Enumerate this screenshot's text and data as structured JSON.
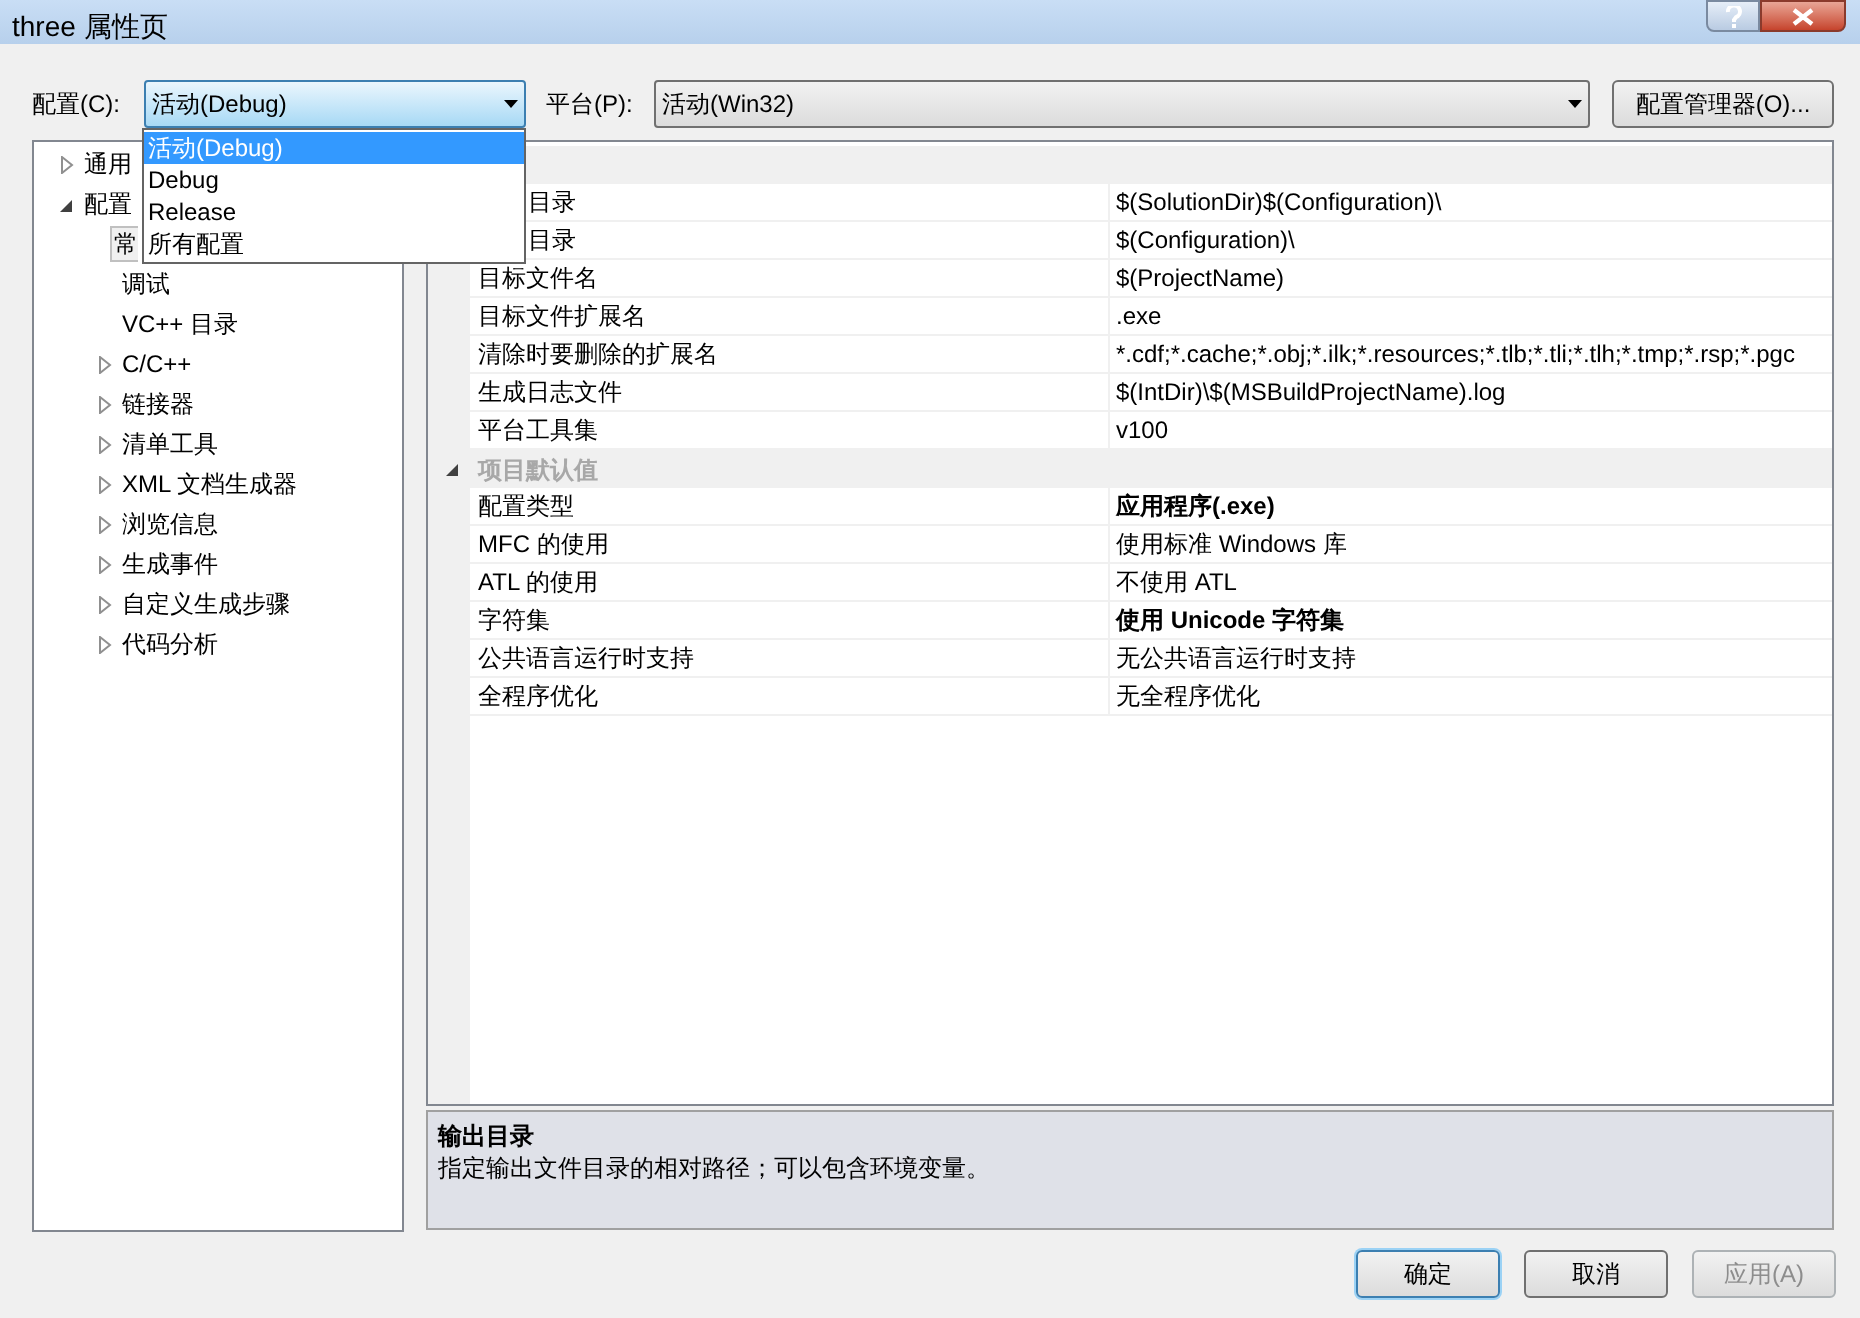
{
  "window": {
    "title": "three 属性页"
  },
  "config": {
    "label": "配置(C):",
    "value": "活动(Debug)",
    "expanded": true,
    "options": [
      {
        "label": "活动(Debug)",
        "selected": true
      },
      {
        "label": "Debug",
        "selected": false
      },
      {
        "label": "Release",
        "selected": false
      },
      {
        "label": "所有配置",
        "selected": false
      }
    ]
  },
  "platform": {
    "label": "平台(P):",
    "value": "活动(Win32)"
  },
  "config_manager_button": "配置管理器(O)...",
  "tree": [
    {
      "label": "通用",
      "expanded": false,
      "selected": false
    },
    {
      "label": "配置",
      "expanded": true,
      "selected": false,
      "children": [
        {
          "label": "常",
          "selected": true
        },
        {
          "label": "调试",
          "selected": false
        },
        {
          "label": "VC++ 目录",
          "selected": false
        },
        {
          "label": "C/C++",
          "expanded": false,
          "selected": false
        },
        {
          "label": "链接器",
          "expanded": false,
          "selected": false
        },
        {
          "label": "清单工具",
          "expanded": false,
          "selected": false
        },
        {
          "label": "XML 文档生成器",
          "expanded": false,
          "selected": false
        },
        {
          "label": "浏览信息",
          "expanded": false,
          "selected": false
        },
        {
          "label": "生成事件",
          "expanded": false,
          "selected": false
        },
        {
          "label": "自定义生成步骤",
          "expanded": false,
          "selected": false
        },
        {
          "label": "代码分析",
          "expanded": false,
          "selected": false
        }
      ]
    }
  ],
  "grid": [
    {
      "kind": "header"
    },
    {
      "kind": "property",
      "name": "目录",
      "value": "$(SolutionDir)$(Configuration)\\",
      "bold": false,
      "covered": true
    },
    {
      "kind": "property",
      "name": "目录",
      "value": "$(Configuration)\\",
      "bold": false,
      "covered": true
    },
    {
      "kind": "property",
      "name": "目标文件名",
      "value": "$(ProjectName)",
      "bold": false
    },
    {
      "kind": "property",
      "name": "目标文件扩展名",
      "value": ".exe",
      "bold": false
    },
    {
      "kind": "property",
      "name": "清除时要删除的扩展名",
      "value": "*.cdf;*.cache;*.obj;*.ilk;*.resources;*.tlb;*.tli;*.tlh;*.tmp;*.rsp;*.pgc",
      "bold": false
    },
    {
      "kind": "property",
      "name": "生成日志文件",
      "value": "$(IntDir)\\$(MSBuildProjectName).log",
      "bold": false
    },
    {
      "kind": "property",
      "name": "平台工具集",
      "value": "v100",
      "bold": false
    },
    {
      "kind": "header",
      "label": "项目默认值",
      "expanded": true
    },
    {
      "kind": "property",
      "name": "配置类型",
      "value": "应用程序(.exe)",
      "bold": true
    },
    {
      "kind": "property",
      "name": "MFC 的使用",
      "value": "使用标准 Windows 库",
      "bold": false
    },
    {
      "kind": "property",
      "name": "ATL 的使用",
      "value": "不使用 ATL",
      "bold": false
    },
    {
      "kind": "property",
      "name": "字符集",
      "value": "使用 Unicode 字符集",
      "bold": true
    },
    {
      "kind": "property",
      "name": "公共语言运行时支持",
      "value": "无公共语言运行时支持",
      "bold": false
    },
    {
      "kind": "property",
      "name": "全程序优化",
      "value": "无全程序优化",
      "bold": false
    }
  ],
  "description": {
    "title": "输出目录",
    "text": "指定输出文件目录的相对路径；可以包含环境变量。"
  },
  "buttons": [
    {
      "label": "确定",
      "disabled": false,
      "focused": true
    },
    {
      "label": "取消",
      "disabled": false,
      "focused": false
    },
    {
      "label": "应用(A)",
      "disabled": true,
      "focused": false
    }
  ]
}
